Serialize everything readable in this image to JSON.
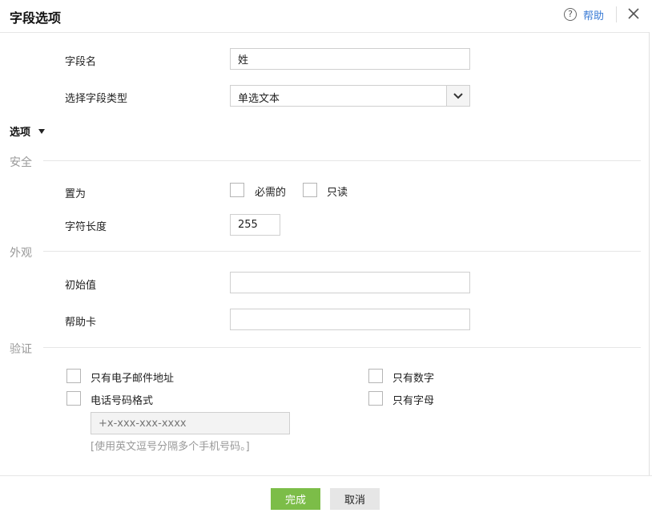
{
  "header": {
    "title": "字段选项",
    "help_label": "帮助"
  },
  "form": {
    "field_name_label": "字段名",
    "field_name_value": "姓",
    "field_type_label": "选择字段类型",
    "field_type_value": "单选文本",
    "section_toggle_label": "选项"
  },
  "security": {
    "title": "安全",
    "set_as_label": "置为",
    "required_label": "必需的",
    "readonly_label": "只读",
    "char_length_label": "字符长度",
    "char_length_value": "255"
  },
  "appearance": {
    "title": "外观",
    "initial_value_label": "初始值",
    "initial_value": "",
    "help_card_label": "帮助卡",
    "help_card_value": ""
  },
  "validation": {
    "title": "验证",
    "email_only_label": "只有电子邮件地址",
    "numbers_only_label": "只有数字",
    "phone_format_label": "电话号码格式",
    "letters_only_label": "只有字母",
    "phone_placeholder": "+x-xxx-xxx-xxxx",
    "phone_hint": "[使用英文逗号分隔多个手机号码。]"
  },
  "footer": {
    "done_label": "完成",
    "cancel_label": "取消"
  },
  "colors": {
    "primary_button": "#7cbd48",
    "link": "#3a7bd5"
  }
}
